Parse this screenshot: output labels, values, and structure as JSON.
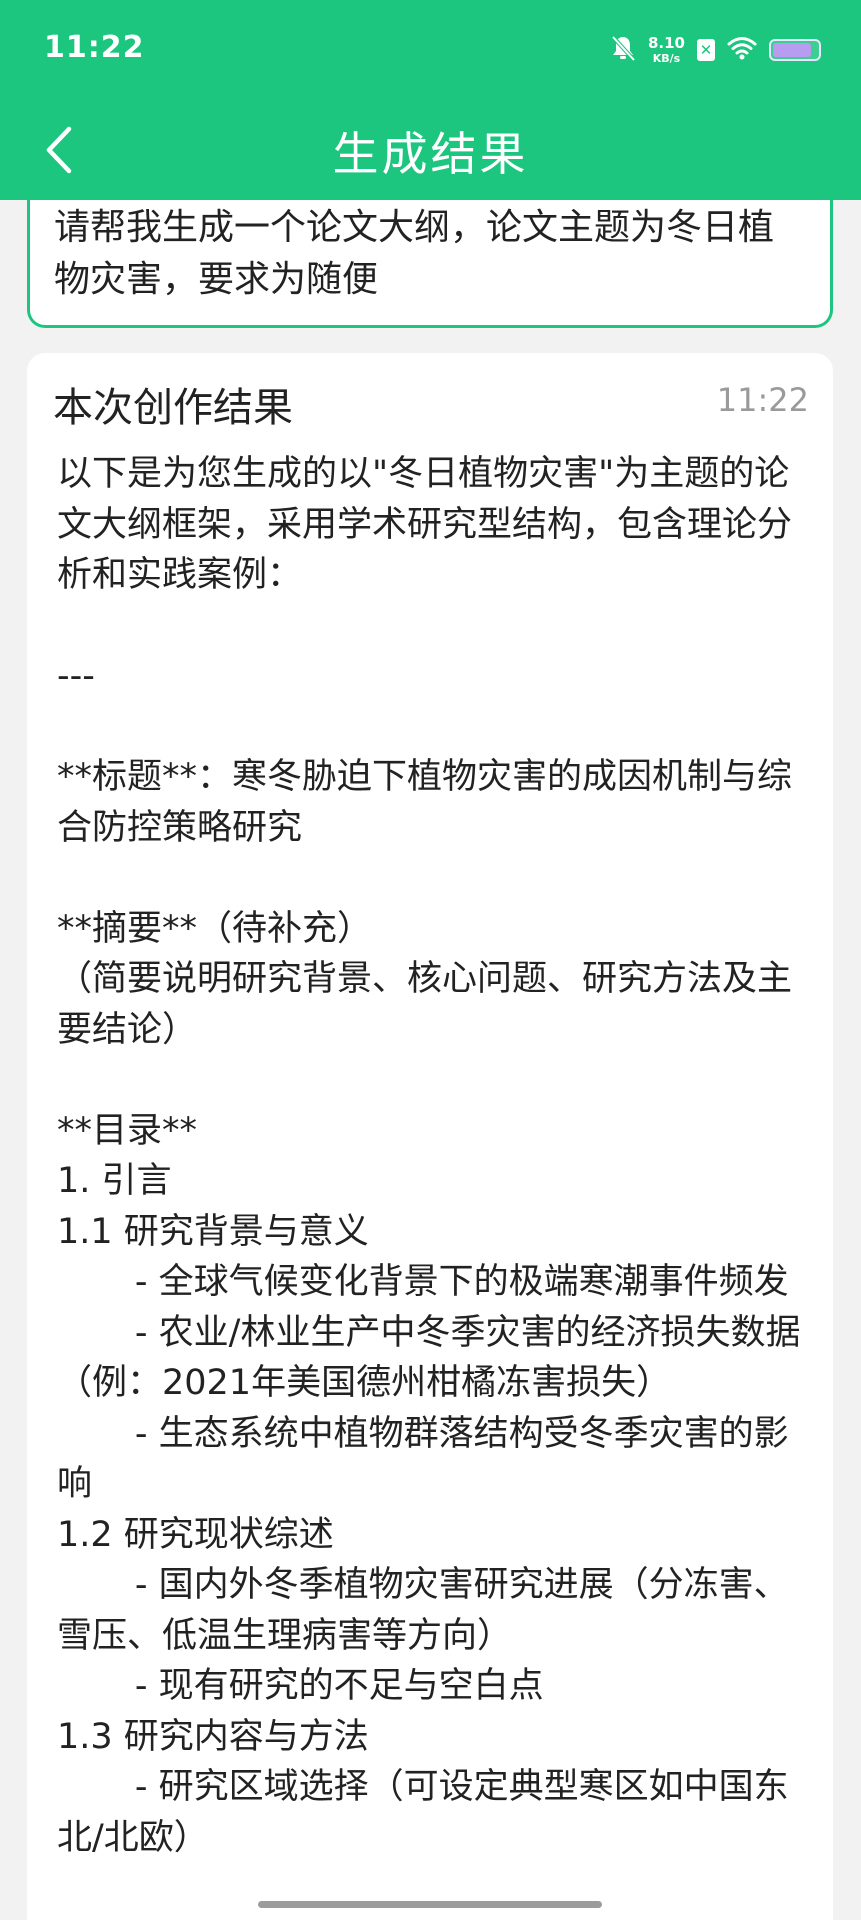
{
  "status_bar": {
    "time": "11:22",
    "net_speed_value": "8.10",
    "net_speed_unit": "KB/s",
    "icons": [
      "bell-off-icon",
      "no-sim-icon",
      "wifi-icon",
      "battery-icon"
    ]
  },
  "header": {
    "title": "生成结果",
    "back_icon": "chevron-left-icon"
  },
  "prompt": {
    "text": "请帮我生成一个论文大纲，论文主题为冬日植物灾害，要求为随便"
  },
  "result": {
    "title": "本次创作结果",
    "time": "11:22",
    "body": "以下是为您生成的以\"冬日植物灾害\"为主题的论文大纲框架，采用学术研究型结构，包含理论分析和实践案例：\n\n---\n\n**标题**：寒冬胁迫下植物灾害的成因机制与综合防控策略研究\n\n**摘要**（待补充）\n（简要说明研究背景、核心问题、研究方法及主要结论）\n\n**目录**\n1. 引言\n1.1 研究背景与意义\n       - 全球气候变化背景下的极端寒潮事件频发\n       - 农业/林业生产中冬季灾害的经济损失数据（例：2021年美国德州柑橘冻害损失）\n       - 生态系统中植物群落结构受冬季灾害的影响\n1.2 研究现状综述\n       - 国内外冬季植物灾害研究进展（分冻害、雪压、低温生理病害等方向）\n       - 现有研究的不足与空白点\n1.3 研究内容与方法\n       - 研究区域选择（可设定典型寒区如中国东北/北欧）"
  },
  "colors": {
    "accent": "#1dc67f",
    "background": "#f2f2f2",
    "card": "#ffffff",
    "time_gray": "#9a9a9a"
  }
}
